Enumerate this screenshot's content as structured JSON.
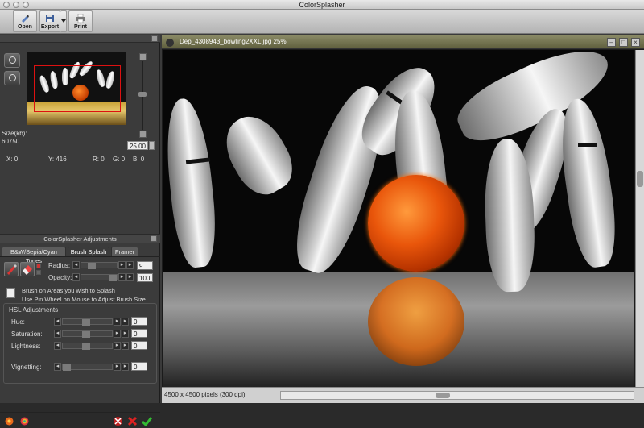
{
  "app": {
    "title": "ColorSplasher"
  },
  "toolbar": {
    "open_label": "Open",
    "export_label": "Export",
    "print_label": "Print"
  },
  "navigator": {
    "size_label": "Size(kb):",
    "size_value": "60750",
    "zoom_value": "25.00",
    "coords": {
      "x": "X: 0",
      "y": "Y: 416",
      "r": "R: 0",
      "g": "G: 0",
      "b": "B: 0"
    }
  },
  "adjustments": {
    "header": "ColorSplasher Adjustments",
    "tabs": [
      "B&W/Sepia/Cyan Tones",
      "Brush Splash",
      "Framer"
    ],
    "active_tab": "Brush Splash",
    "radius_label": "Radius:",
    "radius_value": "9",
    "opacity_label": "Opacity:",
    "opacity_value": "100",
    "hint1": "Brush on Areas you wish to Splash",
    "hint2": "Use Pin Wheel on Mouse to Adjust Brush Size.",
    "hsl_title": "HSL Adjustments",
    "hue_label": "Hue:",
    "hue_value": "0",
    "saturation_label": "Saturation:",
    "saturation_value": "0",
    "lightness_label": "Lightness:",
    "lightness_value": "0",
    "vignetting_label": "Vignetting:",
    "vignetting_value": "0"
  },
  "image_window": {
    "title": "Dep_4308943_bowling2XXL.jpg 25%",
    "status": "4500 x 4500 pixels (300 dpi)"
  },
  "colors": {
    "accent_orange": "#e9560b",
    "title_olive": "#7a7a52",
    "selection_red": "#dd1111"
  }
}
